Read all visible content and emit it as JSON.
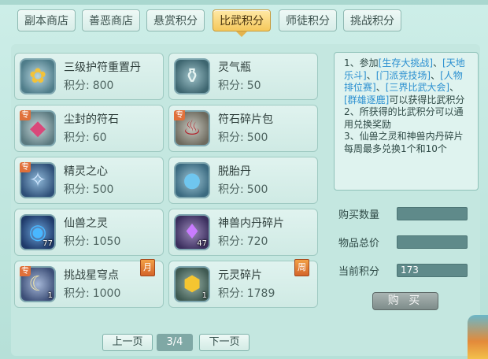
{
  "top_strip_text": "...",
  "tabs": [
    {
      "label": "副本商店",
      "active": false
    },
    {
      "label": "善恶商店",
      "active": false
    },
    {
      "label": "悬赏积分",
      "active": false
    },
    {
      "label": "比武积分",
      "active": true
    },
    {
      "label": "师徒积分",
      "active": false
    },
    {
      "label": "挑战积分",
      "active": false
    }
  ],
  "score_label": "积分:",
  "items": [
    {
      "name": "三级护符重置丹",
      "score": "800",
      "icon": "golden-talisman-icon",
      "special": "",
      "count": "",
      "limit": ""
    },
    {
      "name": "灵气瓶",
      "score": "50",
      "icon": "jade-bottle-icon",
      "special": "",
      "count": "",
      "limit": ""
    },
    {
      "name": "尘封的符石",
      "score": "60",
      "icon": "rune-stone-icon",
      "special": "专",
      "count": "",
      "limit": ""
    },
    {
      "name": "符石碎片包",
      "score": "500",
      "icon": "rune-pouch-icon",
      "special": "专",
      "count": "",
      "limit": ""
    },
    {
      "name": "精灵之心",
      "score": "500",
      "icon": "spirit-heart-icon",
      "special": "专",
      "count": "",
      "limit": ""
    },
    {
      "name": "脱胎丹",
      "score": "500",
      "icon": "pills-icon",
      "special": "",
      "count": "",
      "limit": ""
    },
    {
      "name": "仙兽之灵",
      "score": "1050",
      "icon": "beast-spirit-orb-icon",
      "special": "",
      "count": "77",
      "limit": ""
    },
    {
      "name": "神兽内丹碎片",
      "score": "720",
      "icon": "purple-crystal-icon",
      "special": "",
      "count": "47",
      "limit": ""
    },
    {
      "name": "挑战星穹点",
      "score": "1000",
      "icon": "crescent-moon-icon",
      "special": "专",
      "count": "1",
      "limit": "月"
    },
    {
      "name": "元灵碎片",
      "score": "1789",
      "icon": "gold-fragment-icon",
      "special": "",
      "count": "1",
      "limit": "周"
    }
  ],
  "info": {
    "line1_a": "1、参加",
    "link1": "[生存大挑战]",
    "sep1": "、",
    "link2": "[天地乐斗]",
    "sep2": "、",
    "link3": "[门派竞技场]",
    "sep3": "、",
    "link4": "[人物排位赛]",
    "sep4": "、",
    "link5": "[三界比武大会]",
    "sep5": "、",
    "link6": "[群雄逐鹿]",
    "tail1": "可以获得比武积分",
    "line2": "2、所获得的比武积分可以通用兑换奖励",
    "line3": "3、仙兽之灵和神兽内丹碎片每周最多兑换1个和10个"
  },
  "form": {
    "buy_qty_label": "购买数量",
    "buy_qty_value": "",
    "total_price_label": "物品总价",
    "total_price_value": "",
    "current_score_label": "当前积分",
    "current_score_value": "173"
  },
  "buy_button": "购 买",
  "pager": {
    "prev": "上一页",
    "page": "3/4",
    "next": "下一页"
  }
}
